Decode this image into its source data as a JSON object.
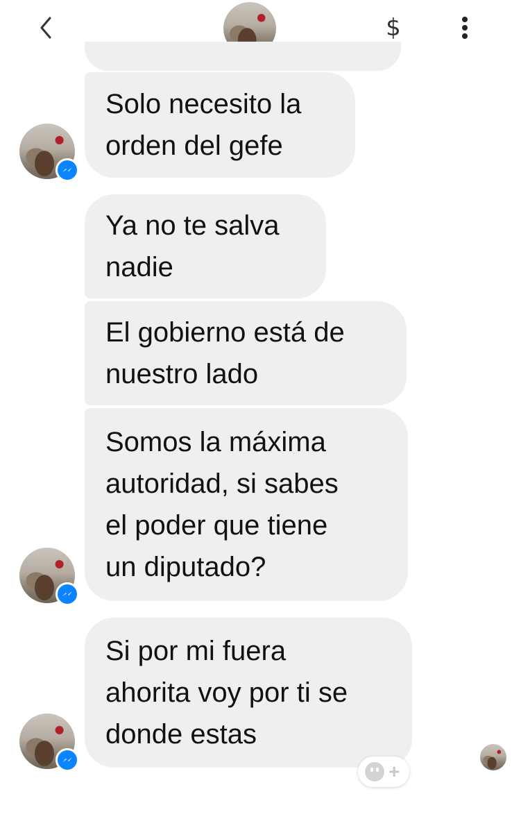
{
  "header": {
    "back_icon": "chevron-left-icon",
    "payment_icon": "dollar-icon",
    "payment_glyph": "$",
    "more_icon": "more-vertical-icon"
  },
  "messages": [
    {
      "text": ""
    },
    {
      "text": "Solo necesito la\norden del gefe"
    },
    {
      "text": "Ya no te salva\nnadie"
    },
    {
      "text": "El gobierno está de\nnuestro lado"
    },
    {
      "text": "Somos la máxima\nautoridad,  si sabes\nel poder que tiene\nun diputado?"
    },
    {
      "text": "Si por mi fuera\nahorita voy por ti se\ndonde estas"
    }
  ],
  "reaction": {
    "icon": "add-reaction-icon",
    "plus": "+"
  },
  "colors": {
    "bubble": "#efeff0",
    "badge": "#0a84ff",
    "text": "#111111"
  }
}
